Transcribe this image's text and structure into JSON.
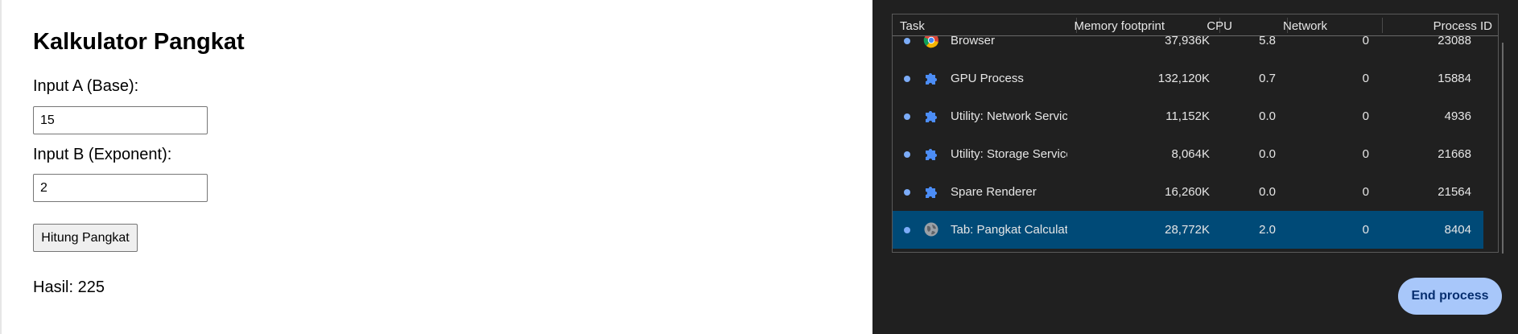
{
  "page": {
    "title": "Kalkulator Pangkat",
    "input_a_label": "Input A (Base):",
    "input_a_value": "15",
    "input_b_label": "Input B (Exponent):",
    "input_b_value": "2",
    "button_label": "Hitung Pangkat",
    "result_text": "Hasil: 225"
  },
  "task_manager": {
    "columns": {
      "task": "Task",
      "memory": "Memory footprint",
      "cpu": "CPU",
      "network": "Network",
      "pid": "Process ID"
    },
    "rows": [
      {
        "name": "Browser",
        "memory": "37,936K",
        "cpu": "5.8",
        "network": "0",
        "pid": "23088",
        "icon": "chrome-icon",
        "selected": false
      },
      {
        "name": "GPU Process",
        "memory": "132,120K",
        "cpu": "0.7",
        "network": "0",
        "pid": "15884",
        "icon": "puzzle-icon",
        "selected": false
      },
      {
        "name": "Utility: Network Servic",
        "memory": "11,152K",
        "cpu": "0.0",
        "network": "0",
        "pid": "4936",
        "icon": "puzzle-icon",
        "selected": false
      },
      {
        "name": "Utility: Storage Service",
        "memory": "8,064K",
        "cpu": "0.0",
        "network": "0",
        "pid": "21668",
        "icon": "puzzle-icon",
        "selected": false
      },
      {
        "name": "Spare Renderer",
        "memory": "16,260K",
        "cpu": "0.0",
        "network": "0",
        "pid": "21564",
        "icon": "puzzle-icon",
        "selected": false
      },
      {
        "name": "Tab: Pangkat Calculato",
        "memory": "28,772K",
        "cpu": "2.0",
        "network": "0",
        "pid": "8404",
        "icon": "globe-icon",
        "selected": true
      }
    ],
    "end_process_label": "End process",
    "colors": {
      "background": "#202020",
      "selected_row": "#004a77",
      "accent": "#a8c7fa",
      "icon_blue": "#4c8df6"
    }
  }
}
